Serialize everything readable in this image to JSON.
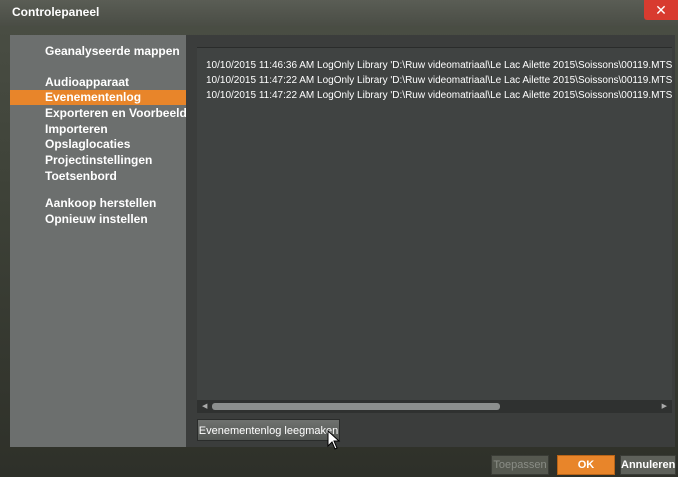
{
  "window": {
    "title": "Controlepaneel",
    "close_label": "✕"
  },
  "sidebar": {
    "items": [
      {
        "label": "Geanalyseerde mappen",
        "active": false
      },
      {
        "label": "Audioapparaat",
        "active": false
      },
      {
        "label": "Evenementenlog",
        "active": true
      },
      {
        "label": "Exporteren en Voorbeeld",
        "active": false
      },
      {
        "label": "Importeren",
        "active": false
      },
      {
        "label": "Opslaglocaties",
        "active": false
      },
      {
        "label": "Projectinstellingen",
        "active": false
      },
      {
        "label": "Toetsenbord",
        "active": false
      },
      {
        "label": "Aankoop herstellen",
        "active": false
      },
      {
        "label": "Opnieuw instellen",
        "active": false
      }
    ]
  },
  "log": {
    "lines": [
      "10/10/2015 11:46:36 AM  LogOnly  Library  'D:\\Ruw videomatriaal\\Le Lac Ailette 2015\\Soissons\\00119.MTS",
      "10/10/2015 11:47:22 AM  LogOnly  Library  'D:\\Ruw videomatriaal\\Le Lac Ailette 2015\\Soissons\\00119.MTS",
      "10/10/2015 11:47:22 AM  LogOnly  Library  'D:\\Ruw videomatriaal\\Le Lac Ailette 2015\\Soissons\\00119.MTS"
    ]
  },
  "buttons": {
    "clear_log": "Evenementenlog leegmaken",
    "apply": "Toepassen",
    "ok": "OK",
    "cancel": "Annuleren"
  },
  "colors": {
    "accent": "#e8852a",
    "close": "#d83b2f"
  }
}
